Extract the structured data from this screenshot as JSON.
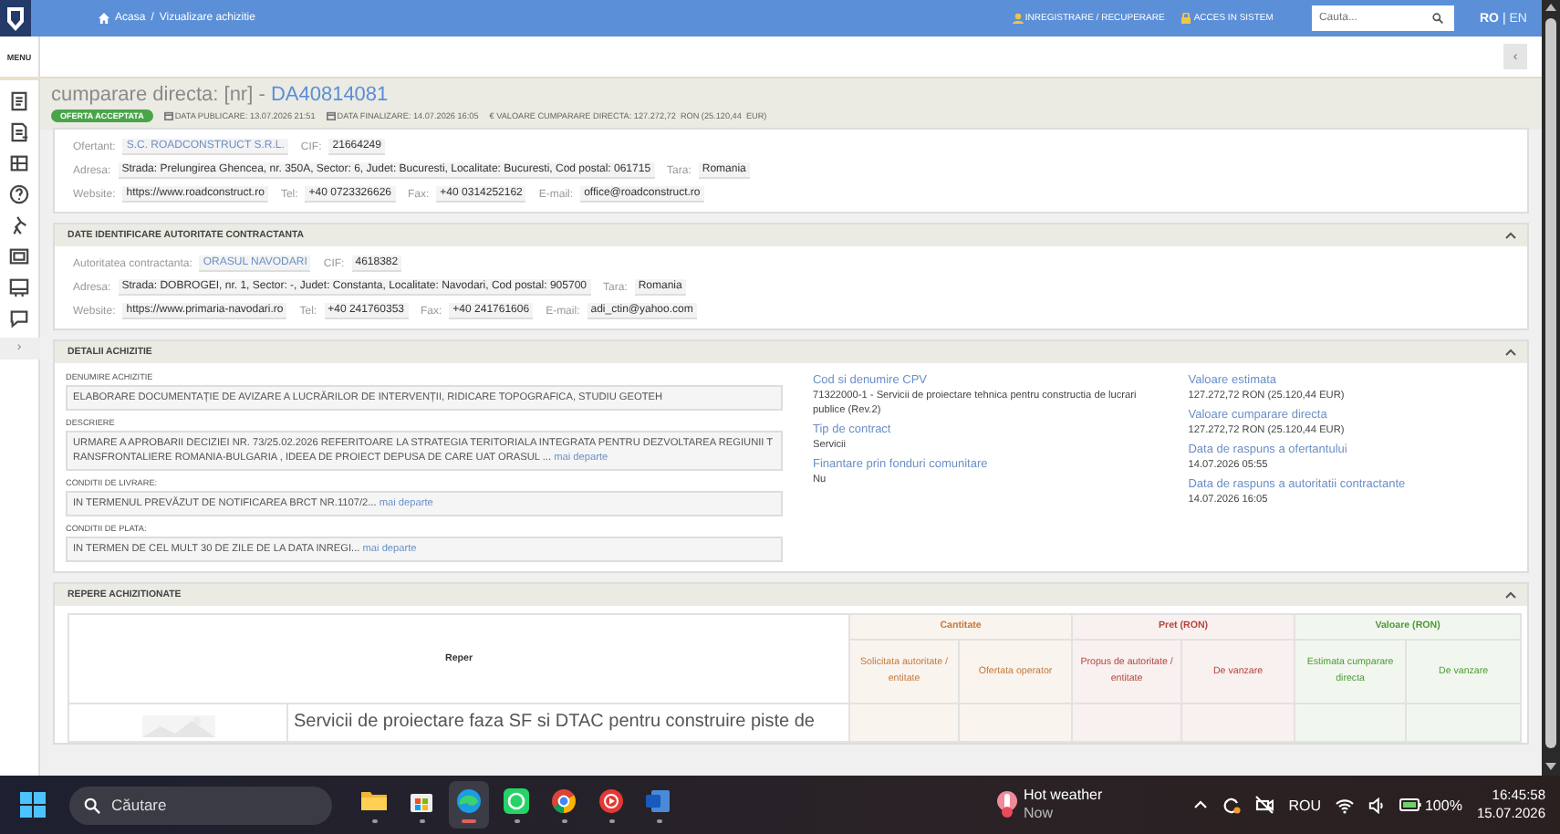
{
  "topbar": {
    "breadcrumb": [
      "Acasa",
      "Vizualizare achizitie"
    ],
    "separator": "/",
    "links": [
      {
        "kind": "person",
        "label": "INREGISTRARE / RECUPERARE"
      },
      {
        "kind": "lock",
        "label": "ACCES IN SISTEM"
      }
    ],
    "search": {
      "placeholder": "Cauta..."
    },
    "languages": [
      {
        "label": "RO",
        "selected": true
      },
      {
        "label": "EN",
        "selected": false
      }
    ],
    "language_separator": "|"
  },
  "sidebar": {
    "menu_label": "MENU",
    "toggle": "›"
  },
  "collapse_button": "‹",
  "header": {
    "title": "cumparare directa: [nr] - ",
    "code": "DA40814081",
    "status": "OFERTA ACCEPTATA",
    "meta": [
      {
        "kind": "calendar",
        "text": "DATA PUBLICARE: 13.07.2026 21:51"
      },
      {
        "kind": "calendar",
        "text": "DATA FINALIZARE: 14.07.2026 16:05"
      },
      {
        "kind": "plain",
        "text": "€ VALOARE CUMPARARE DIRECTA: 127.272,72  RON (25.120,44  EUR)"
      }
    ]
  },
  "bidder": {
    "identity": [
      {
        "label": "Ofertant:",
        "value": "S.C. ROADCONSTRUCT S.R.L.",
        "kind": "link"
      },
      {
        "label": "CIF:",
        "value": "21664249",
        "kind": "text"
      }
    ],
    "address": [
      {
        "label": "Adresa:",
        "value": "Strada: Prelungirea Ghencea, nr. 350A, Sector: 6, Judet: Bucuresti, Localitate: Bucuresti, Cod postal: 061715",
        "kind": "text"
      },
      {
        "label": "Tara:",
        "value": "Romania",
        "kind": "text"
      }
    ],
    "contact": [
      {
        "label": "Website:",
        "value": "https://www.roadconstruct.ro",
        "kind": "text"
      },
      {
        "label": "Tel:",
        "value": "+40 0723326626",
        "kind": "text"
      },
      {
        "label": "Fax:",
        "value": "+40 0314252162",
        "kind": "text"
      },
      {
        "label": "E-mail:",
        "value": "office@roadconstruct.ro",
        "kind": "text"
      }
    ]
  },
  "authority": {
    "title": "DATE IDENTIFICARE AUTORITATE CONTRACTANTA",
    "expanded": true,
    "identity": [
      {
        "label": "Autoritatea contractanta:",
        "value": "ORASUL NAVODARI",
        "kind": "link"
      },
      {
        "label": "CIF:",
        "value": "4618382",
        "kind": "text"
      }
    ],
    "address": [
      {
        "label": "Adresa:",
        "value": "Strada: DOBROGEI, nr. 1, Sector: -, Judet: Constanta, Localitate: Navodari, Cod postal: 905700",
        "kind": "text"
      },
      {
        "label": "Tara:",
        "value": "Romania",
        "kind": "text"
      }
    ],
    "contact": [
      {
        "label": "Website:",
        "value": "https://www.primaria-navodari.ro",
        "kind": "text"
      },
      {
        "label": "Tel:",
        "value": "+40 241760353",
        "kind": "text"
      },
      {
        "label": "Fax:",
        "value": "+40 241761606",
        "kind": "text"
      },
      {
        "label": "E-mail:",
        "value": "adi_ctin@yahoo.com",
        "kind": "text"
      }
    ]
  },
  "details": {
    "title": "DETALII ACHIZITIE",
    "expanded": true,
    "fields": [
      {
        "label": "DENUMIRE ACHIZITIE",
        "value": "ELABORARE DOCUMENTAȚIE DE AVIZARE A LUCRĂRILOR DE INTERVENȚII, RIDICARE TOPOGRAFICA, STUDIU GEOTEH"
      },
      {
        "label": "DESCRIERE",
        "value": "URMARE A APROBARII DECIZIEI NR. 73/25.02.2026 REFERITOARE LA STRATEGIA TERITORIALA INTEGRATA PENTRU DEZVOLTAREA REGIUNII TRANSFRONTALIERE ROMANIA-BULGARIA , IDEEA DE PROIECT DEPUSA DE CARE UAT ORASUL ...",
        "more": "mai departe"
      },
      {
        "label": "CONDITII DE LIVRARE:",
        "value": "IN TERMENUL PREVĂZUT DE NOTIFICAREA BRCT NR.1107/2...",
        "more": "mai departe"
      },
      {
        "label": "CONDITII DE PLATA:",
        "value": "IN TERMEN DE CEL MULT 30 DE ZILE DE LA DATA INREGI...",
        "more": "mai departe"
      }
    ],
    "middle": [
      {
        "label": "Cod si denumire CPV",
        "value": "71322000-1 - Servicii de proiectare tehnica pentru constructia de lucrari publice (Rev.2)"
      },
      {
        "label": "Tip de contract",
        "value": "Servicii"
      },
      {
        "label": "Finantare prin fonduri comunitare",
        "value": "Nu"
      }
    ],
    "right": [
      {
        "label": "Valoare estimata",
        "value": "127.272,72  RON (25.120,44  EUR)"
      },
      {
        "label": "Valoare cumparare directa",
        "value": "127.272,72  RON (25.120,44  EUR)"
      },
      {
        "label": "Data de raspuns a ofertantului",
        "value": "14.07.2026 05:55"
      },
      {
        "label": "Data de raspuns a autoritatii contractante",
        "value": "14.07.2026 16:05"
      }
    ]
  },
  "items": {
    "title": "REPERE ACHIZITIONATE",
    "expanded": true,
    "reper_heading": "Reper",
    "groups": [
      {
        "title": "Cantitate",
        "color": "#c47a3c",
        "columns": [
          "Solicitata autoritate / entitate",
          "Ofertata operator"
        ]
      },
      {
        "title": "Pret (RON)",
        "color": "#b3463e",
        "columns": [
          "Propus de autoritate / entitate",
          "De vanzare"
        ]
      },
      {
        "title": "Valoare (RON)",
        "color": "#4f9a36",
        "columns": [
          "Estimata cumparare directa",
          "De vanzare"
        ]
      }
    ],
    "rows": [
      {
        "name": "Servicii de proiectare faza SF si DTAC pentru construire piste de"
      }
    ]
  },
  "taskbar": {
    "search": {
      "placeholder": "Căutare"
    },
    "apps": [
      {
        "kind": "folder",
        "selected": false
      },
      {
        "kind": "store",
        "selected": false
      },
      {
        "kind": "edge",
        "selected": true
      },
      {
        "kind": "whatsapp",
        "selected": false
      },
      {
        "kind": "chrome",
        "selected": false
      },
      {
        "kind": "music",
        "selected": false
      },
      {
        "kind": "word",
        "selected": false
      }
    ],
    "weather": {
      "title": "Hot weather",
      "subtitle": "Now"
    },
    "language": "ROU",
    "battery": "100%",
    "time": "16:45:58",
    "date": "15.07.2026"
  }
}
